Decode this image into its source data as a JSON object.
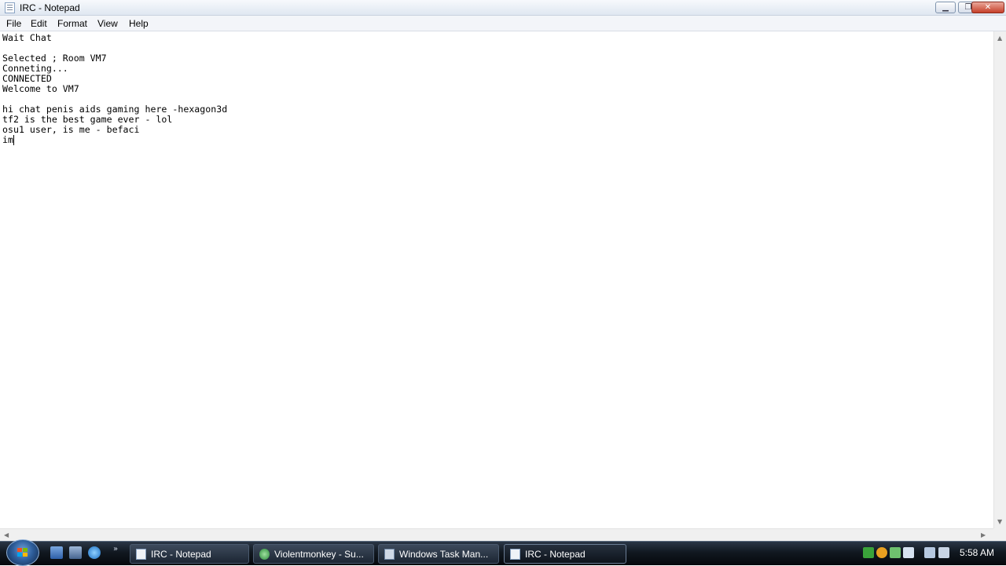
{
  "window": {
    "title": "IRC - Notepad"
  },
  "menu": [
    "File",
    "Edit",
    "Format",
    "View",
    "Help"
  ],
  "editor": {
    "lines": [
      "Wait Chat",
      "",
      "Selected ; Room VM7",
      "Conneting...",
      "CONNECTED",
      "Welcome to VM7",
      "",
      "hi chat penis aids gaming here -hexagon3d",
      "tf2 is the best game ever - lol",
      "osu1 user, is me - befaci",
      "im"
    ]
  },
  "taskbar": {
    "tasks": [
      {
        "label": "IRC - Notepad",
        "icon": "notepad-icon"
      },
      {
        "label": "Violentmonkey - Su...",
        "icon": "browser-icon"
      },
      {
        "label": "Windows Task Man...",
        "icon": "task-manager-icon"
      },
      {
        "label": "IRC - Notepad",
        "icon": "notepad-icon",
        "active": true
      }
    ],
    "quicklaunch_chevron": "»",
    "clock": "5:58 AM"
  },
  "colors": {
    "taskbar": "#111820",
    "editor_bg": "#ffffff",
    "titlebar": "#dfe7f1",
    "close_button": "#c6402a"
  }
}
